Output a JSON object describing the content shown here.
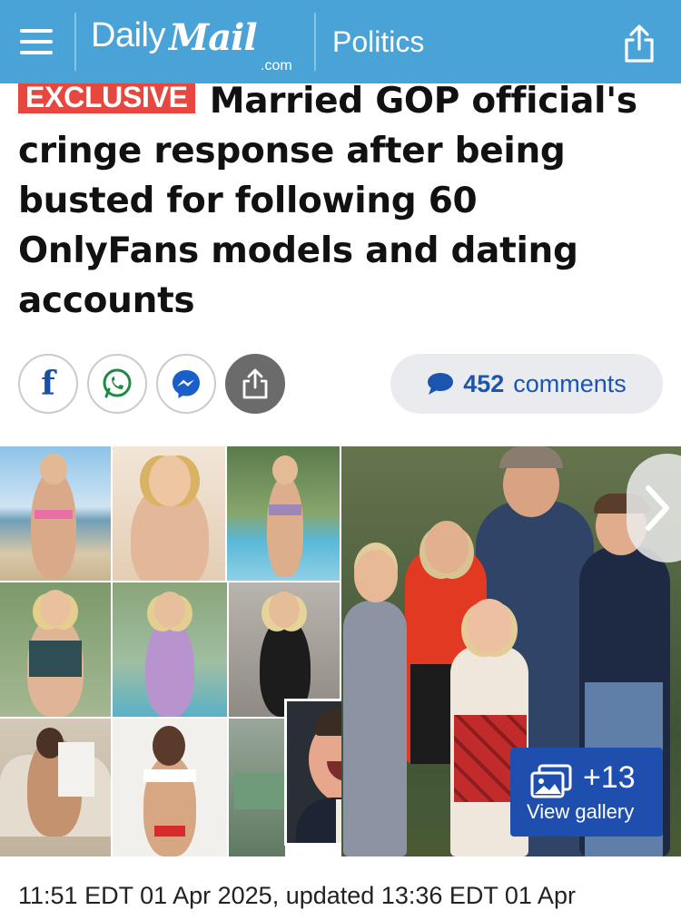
{
  "header": {
    "menu_icon": "hamburger-menu-icon",
    "logo_daily": "Daily",
    "logo_mail": "Mail",
    "logo_dotcom": ".com",
    "section": "Politics",
    "share_icon": "share-icon",
    "bg_color": "#4aa3d6"
  },
  "article": {
    "badge": "EXCLUSIVE",
    "badge_color": "#e8473f",
    "headline": "Married GOP official's cringe response after being busted for following 60 OnlyFans models and dating accounts"
  },
  "social": {
    "buttons": [
      {
        "name": "facebook",
        "icon": "facebook-icon"
      },
      {
        "name": "whatsapp",
        "icon": "whatsapp-icon"
      },
      {
        "name": "messenger",
        "icon": "messenger-icon"
      },
      {
        "name": "share",
        "icon": "share-icon"
      }
    ],
    "comments_count": "452",
    "comments_label": "comments"
  },
  "gallery": {
    "count": "+13",
    "label": "View gallery",
    "next_icon": "chevron-right-icon"
  },
  "timestamp": "11:51 EDT 01 Apr 2025, updated 13:36 EDT 01 Apr"
}
